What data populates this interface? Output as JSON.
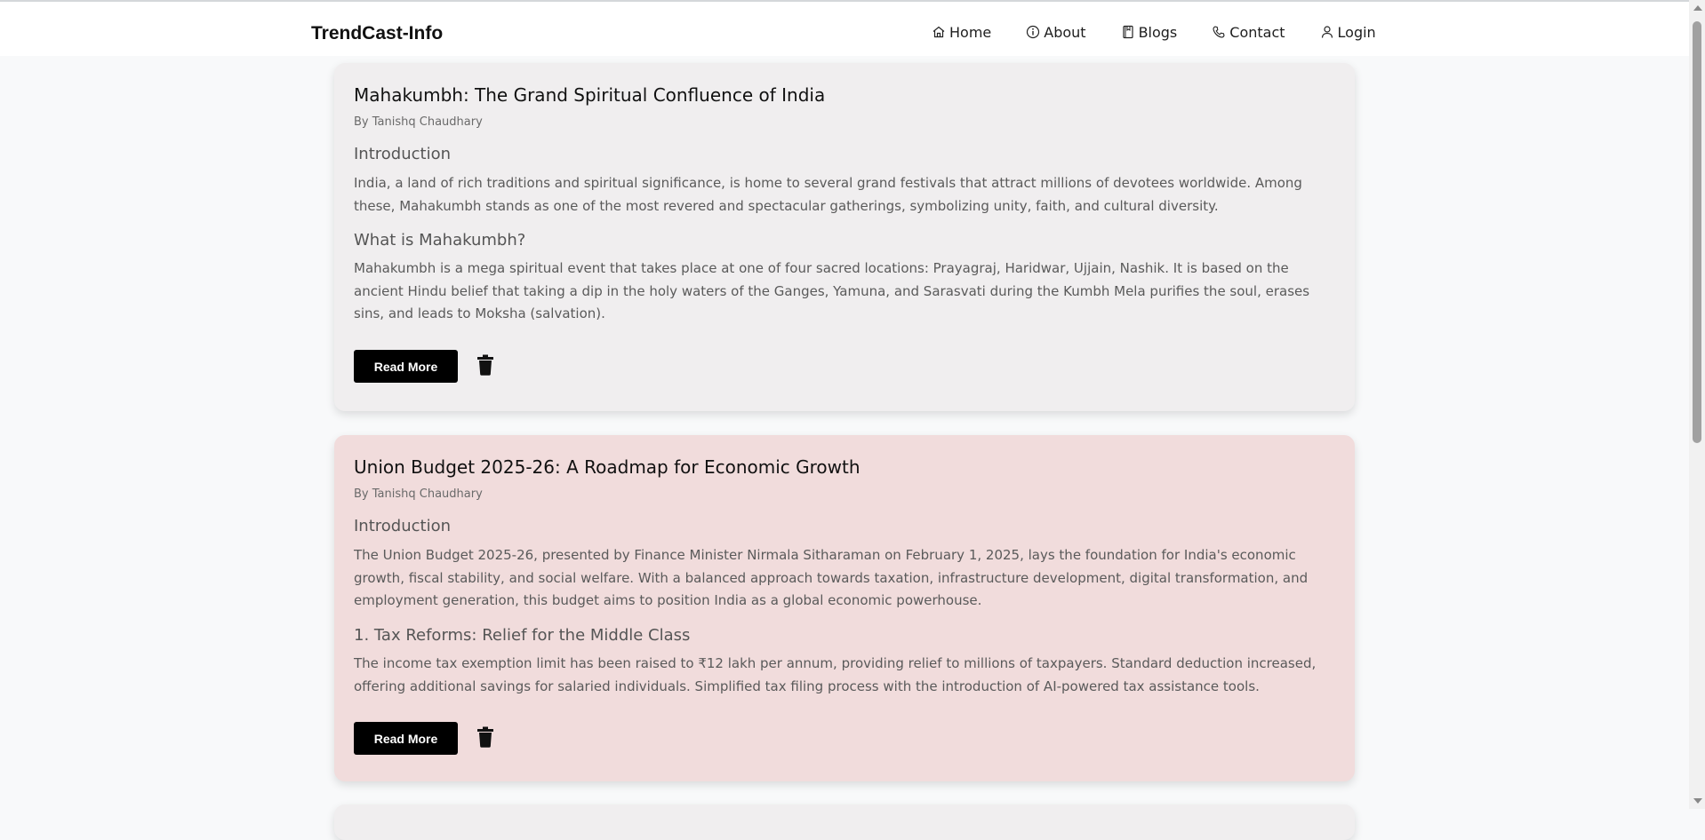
{
  "navbar": {
    "brand": "TrendCast-Info",
    "links": [
      {
        "label": "Home",
        "icon": "home-icon"
      },
      {
        "label": "About",
        "icon": "info-icon"
      },
      {
        "label": "Blogs",
        "icon": "book-icon"
      },
      {
        "label": "Contact",
        "icon": "phone-icon"
      },
      {
        "label": "Login",
        "icon": "user-icon"
      }
    ]
  },
  "posts": [
    {
      "title": "Mahakumbh: The Grand Spiritual Confluence of India",
      "author": "By Tanishq Chaudhary",
      "heading1": "Introduction",
      "para1": "India, a land of rich traditions and spiritual significance, is home to several grand festivals that attract millions of devotees worldwide. Among these, Mahakumbh stands as one of the most revered and spectacular gatherings, symbolizing unity, faith, and cultural diversity.",
      "heading2": "What is Mahakumbh?",
      "para2": "Mahakumbh is a mega spiritual event that takes place at one of four sacred locations: Prayagraj, Haridwar, Ujjain, Nashik. It is based on the ancient Hindu belief that taking a dip in the holy waters of the Ganges, Yamuna, and Sarasvati during the Kumbh Mela purifies the soul, erases sins, and leads to Moksha (salvation).",
      "read_more": "Read More",
      "bg": "#f0eeef"
    },
    {
      "title": "Union Budget 2025-26: A Roadmap for Economic Growth",
      "author": "By Tanishq Chaudhary",
      "heading1": "Introduction",
      "para1": "The Union Budget 2025-26, presented by Finance Minister Nirmala Sitharaman on February 1, 2025, lays the foundation for India's economic growth, fiscal stability, and social welfare. With a balanced approach towards taxation, infrastructure development, digital transformation, and employment generation, this budget aims to position India as a global economic powerhouse.",
      "heading2": "1. Tax Reforms: Relief for the Middle Class",
      "para2": "The income tax exemption limit has been raised to ₹12 lakh per annum, providing relief to millions of taxpayers. Standard deduction increased, offering additional savings for salaried individuals. Simplified tax filing process with the introduction of AI-powered tax assistance tools.",
      "read_more": "Read More",
      "bg": "#f1dcdc"
    }
  ],
  "colors": {
    "page_bg": "#f8f9fa",
    "button_bg": "#000000"
  }
}
